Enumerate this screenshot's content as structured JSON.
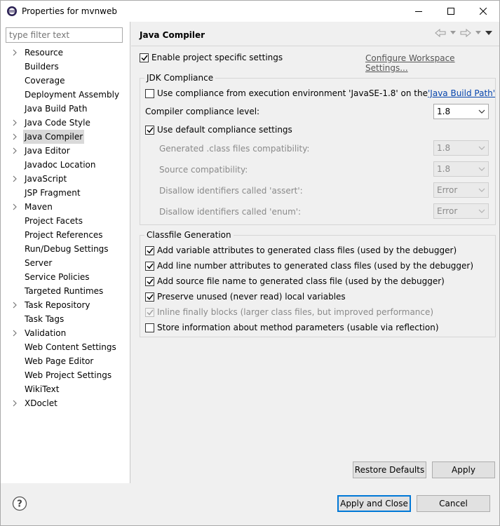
{
  "window": {
    "title": "Properties for mvnweb"
  },
  "filter": {
    "placeholder": "type filter text"
  },
  "tree": [
    {
      "label": "Resource",
      "expandable": true
    },
    {
      "label": "Builders",
      "expandable": false
    },
    {
      "label": "Coverage",
      "expandable": false
    },
    {
      "label": "Deployment Assembly",
      "expandable": false
    },
    {
      "label": "Java Build Path",
      "expandable": false
    },
    {
      "label": "Java Code Style",
      "expandable": true
    },
    {
      "label": "Java Compiler",
      "expandable": true,
      "selected": true
    },
    {
      "label": "Java Editor",
      "expandable": true
    },
    {
      "label": "Javadoc Location",
      "expandable": false
    },
    {
      "label": "JavaScript",
      "expandable": true
    },
    {
      "label": "JSP Fragment",
      "expandable": false
    },
    {
      "label": "Maven",
      "expandable": true
    },
    {
      "label": "Project Facets",
      "expandable": false
    },
    {
      "label": "Project References",
      "expandable": false
    },
    {
      "label": "Run/Debug Settings",
      "expandable": false
    },
    {
      "label": "Server",
      "expandable": false
    },
    {
      "label": "Service Policies",
      "expandable": false
    },
    {
      "label": "Targeted Runtimes",
      "expandable": false
    },
    {
      "label": "Task Repository",
      "expandable": true
    },
    {
      "label": "Task Tags",
      "expandable": false
    },
    {
      "label": "Validation",
      "expandable": true
    },
    {
      "label": "Web Content Settings",
      "expandable": false
    },
    {
      "label": "Web Page Editor",
      "expandable": false
    },
    {
      "label": "Web Project Settings",
      "expandable": false
    },
    {
      "label": "WikiText",
      "expandable": false
    },
    {
      "label": "XDoclet",
      "expandable": true
    }
  ],
  "page": {
    "title": "Java Compiler",
    "enable_specific": {
      "label": "Enable project specific settings",
      "checked": true
    },
    "configure_link": "Configure Workspace Settings..."
  },
  "jdk": {
    "group_label": "JDK Compliance",
    "use_exec_env": {
      "label": "Use compliance from execution environment 'JavaSE-1.8' on the ",
      "link": "'Java Build Path'",
      "checked": false
    },
    "compliance_level": {
      "label": "Compiler compliance level:",
      "value": "1.8"
    },
    "use_default": {
      "label": "Use default compliance settings",
      "checked": true
    },
    "generated_class": {
      "label": "Generated .class files compatibility:",
      "value": "1.8"
    },
    "source_compat": {
      "label": "Source compatibility:",
      "value": "1.8"
    },
    "assert_ident": {
      "label": "Disallow identifiers called 'assert':",
      "value": "Error"
    },
    "enum_ident": {
      "label": "Disallow identifiers called 'enum':",
      "value": "Error"
    }
  },
  "classfile": {
    "group_label": "Classfile Generation",
    "options": [
      {
        "label": "Add variable attributes to generated class files (used by the debugger)",
        "checked": true,
        "disabled": false
      },
      {
        "label": "Add line number attributes to generated class files (used by the debugger)",
        "checked": true,
        "disabled": false
      },
      {
        "label": "Add source file name to generated class file (used by the debugger)",
        "checked": true,
        "disabled": false
      },
      {
        "label": "Preserve unused (never read) local variables",
        "checked": true,
        "disabled": false
      },
      {
        "label": "Inline finally blocks (larger class files, but improved performance)",
        "checked": true,
        "disabled": true
      },
      {
        "label": "Store information about method parameters (usable via reflection)",
        "checked": false,
        "disabled": false
      }
    ]
  },
  "buttons": {
    "restore_defaults": "Restore Defaults",
    "apply": "Apply",
    "apply_close": "Apply and Close",
    "cancel": "Cancel"
  },
  "colors": {
    "accent": "#0078d7",
    "link": "#0645ad",
    "selection": "#d9d9d9"
  }
}
